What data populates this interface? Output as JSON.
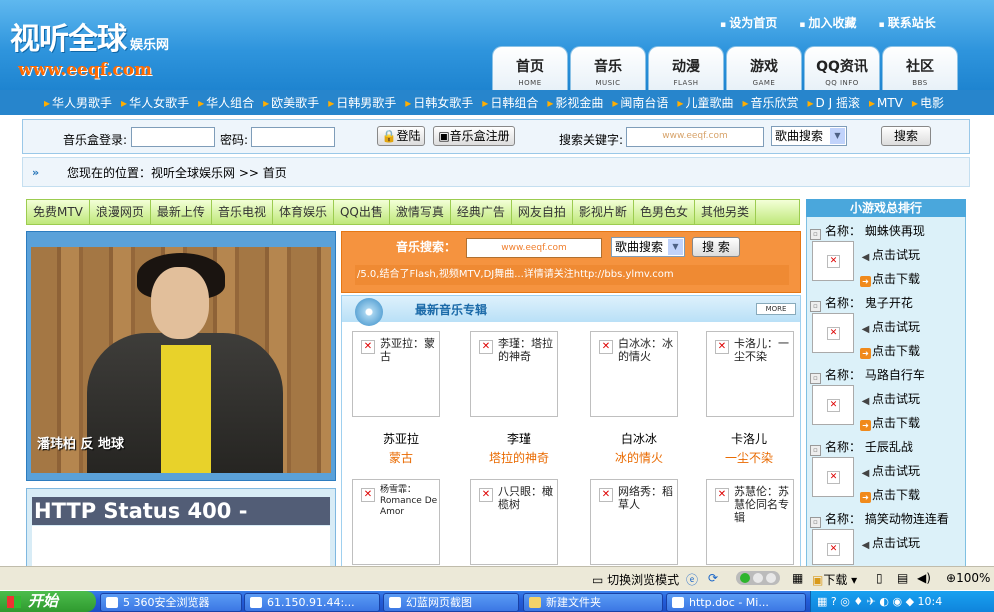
{
  "header": {
    "logo_text": "视听全球",
    "logo_sub": "娱乐网",
    "logo_url": "www.eeqf.com",
    "top_links": [
      "设为首页",
      "加入收藏",
      "联系站长"
    ],
    "nav_tabs": [
      {
        "zh": "首页",
        "en": "HOME"
      },
      {
        "zh": "音乐",
        "en": "MUSIC"
      },
      {
        "zh": "动漫",
        "en": "FLASH"
      },
      {
        "zh": "游戏",
        "en": "GAME"
      },
      {
        "zh": "QQ资讯",
        "en": "QQ INFO"
      },
      {
        "zh": "社区",
        "en": "BBS"
      }
    ]
  },
  "category_bar": [
    "华人男歌手",
    "华人女歌手",
    "华人组合",
    "欧美歌手",
    "日韩男歌手",
    "日韩女歌手",
    "日韩组合",
    "影视金曲",
    "闽南台语",
    "儿童歌曲",
    "音乐欣赏",
    "D J 摇滚",
    "MTV",
    "电影"
  ],
  "login_bar": {
    "login_label": "音乐盒登录:",
    "password_label": "密码:",
    "login_button": "登陆",
    "register_button": "音乐盒注册",
    "search_label": "搜索关键字:",
    "search_placeholder": "www.eeqf.com",
    "search_type": "歌曲搜索",
    "search_button": "搜索"
  },
  "breadcrumb": {
    "text": "您现在的位置：视听全球娱乐网 >> 首页"
  },
  "green_menu": [
    "免费MTV",
    "浪漫网页",
    "最新上传",
    "音乐电视",
    "体育娱乐",
    "QQ出售",
    "激情写真",
    "经典广告",
    "网友自拍",
    "影视片断",
    "色男色女",
    "其他另类"
  ],
  "poster": {
    "caption": "潘玮柏 反 地球"
  },
  "error_box": {
    "title": "HTTP Status 400 -"
  },
  "music_search": {
    "label": "音乐搜索：",
    "placeholder": "www.eeqf.com",
    "type": "歌曲搜索",
    "button": "搜 索",
    "marquee": "/5.0,结合了Flash,视频MTV,DJ舞曲...详情请关注http://bbs.ylmv.com"
  },
  "albums": {
    "title": "最新音乐专辑",
    "more": "MORE",
    "items": [
      {
        "img_text": "苏亚拉：蒙古",
        "artist": "苏亚拉",
        "album": "蒙古"
      },
      {
        "img_text": "李瑾：塔拉的神奇",
        "artist": "李瑾",
        "album": "塔拉的神奇"
      },
      {
        "img_text": "白冰冰：冰的情火",
        "artist": "白冰冰",
        "album": "冰的情火"
      },
      {
        "img_text": "卡洛儿：一尘不染",
        "artist": "卡洛儿",
        "album": "一尘不染"
      },
      {
        "img_text": "杨雪霏：Romance De Amor",
        "artist": "",
        "album": ""
      },
      {
        "img_text": "八只眼：橄榄树",
        "artist": "",
        "album": ""
      },
      {
        "img_text": "网络秀：稻草人",
        "artist": "",
        "album": ""
      },
      {
        "img_text": "苏慧伦：苏慧伦同名专辑",
        "artist": "",
        "album": ""
      }
    ]
  },
  "game_rank": {
    "title": "小游戏总排行",
    "name_label": "名称：",
    "play_label": "点击试玩",
    "download_label": "点击下载",
    "items": [
      "蜘蛛侠再现",
      "鬼子开花",
      "马路自行车",
      "壬辰乱战",
      "搞笑动物连连看"
    ]
  },
  "ie_status": {
    "switch_mode": "切换浏览模式",
    "download": "下载",
    "zoom": "100%"
  },
  "taskbar": {
    "start": "开始",
    "tasks": [
      "5 360安全浏览器",
      "61.150.91.44:...",
      "幻蓝网页截图",
      "新建文件夹",
      "http.doc - Mi..."
    ],
    "clock": "10:4"
  },
  "colors": {
    "header_blue": "#2f95dd",
    "orange": "#f5933f",
    "menu_green": "#bfe87a",
    "error_header": "#525d76"
  }
}
